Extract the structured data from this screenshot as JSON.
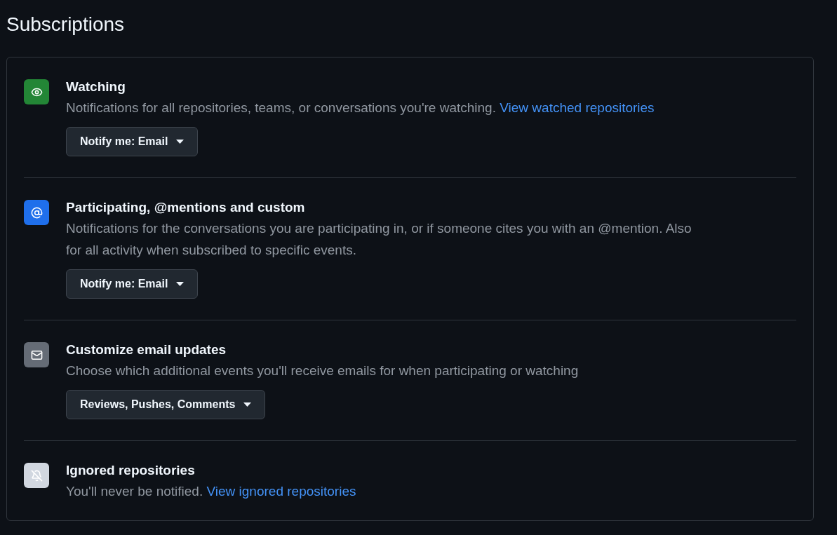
{
  "page": {
    "title": "Subscriptions"
  },
  "sections": [
    {
      "kind": "watch",
      "color": "#238636",
      "title": "Watching",
      "description": "Notifications for all repositories, teams, or conversations you're watching.",
      "link": "View watched repositories",
      "button": "Notify me: Email"
    },
    {
      "kind": "mention",
      "color": "#1f6feb",
      "title": "Participating, @mentions and custom",
      "description": "Notifications for the conversations you are participating in, or if someone cites you with an @mention. Also for all activity when subscribed to specific events.",
      "button": "Notify me: Email"
    },
    {
      "kind": "email",
      "color": "#656c76",
      "title": "Customize email updates",
      "description": "Choose which additional events you'll receive emails for when participating or watching",
      "button": "Reviews, Pushes, Comments"
    },
    {
      "kind": "ignore",
      "color": "#d1d7e0",
      "title": "Ignored repositories",
      "description": "You'll never be notified.",
      "link": "View ignored repositories"
    }
  ]
}
